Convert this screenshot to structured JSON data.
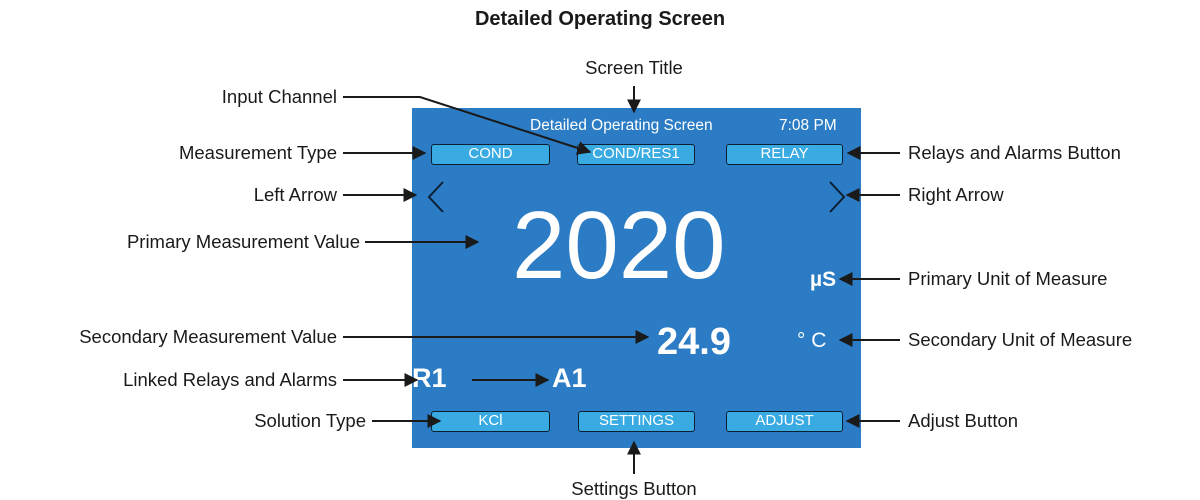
{
  "heading": "Detailed Operating Screen",
  "labels": {
    "screen_title": "Screen Title",
    "input_channel": "Input Channel",
    "measurement_type": "Measurement Type",
    "left_arrow": "Left Arrow",
    "primary_value": "Primary Measurement Value",
    "secondary_value": "Secondary Measurement Value",
    "linked_relays": "Linked Relays and Alarms",
    "solution_type": "Solution Type",
    "relays_button": "Relays and Alarms Button",
    "right_arrow": "Right Arrow",
    "primary_unit": "Primary Unit of Measure",
    "secondary_unit": "Secondary Unit of Measure",
    "adjust_button": "Adjust Button",
    "settings_button": "Settings Button"
  },
  "screen": {
    "title": "Detailed Operating Screen",
    "time": "7:08 PM",
    "btn_type": "COND",
    "btn_channel": "COND/RES1",
    "btn_relay": "RELAY",
    "primary_value": "2020",
    "primary_unit": "µS",
    "secondary_value": "24.9",
    "secondary_unit": "° C",
    "relay": "R1",
    "alarm": "A1",
    "btn_solution": "KCl",
    "btn_settings": "SETTINGS",
    "btn_adjust": "ADJUST"
  },
  "colors": {
    "screen_bg": "#2b7cc4",
    "button_bg": "#3aabe2",
    "text": "#ffffff"
  }
}
